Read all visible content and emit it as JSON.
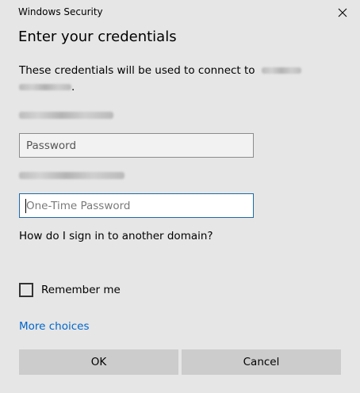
{
  "window": {
    "title": "Windows Security",
    "close_icon": "close-icon"
  },
  "dialog": {
    "heading": "Enter your credentials",
    "description": "These credentials will be used to connect to",
    "description_end": "."
  },
  "form": {
    "password_placeholder": "Password",
    "password_value": "",
    "otp_placeholder": "One-Time Password",
    "otp_value": "",
    "other_domain_text": "How do I sign in to another domain?",
    "remember_label": "Remember me",
    "remember_checked": false,
    "more_choices_label": "More choices"
  },
  "buttons": {
    "ok_label": "OK",
    "cancel_label": "Cancel"
  },
  "colors": {
    "background": "#e6e6e6",
    "link": "#0066cc",
    "focus_border": "#1c6aa8",
    "button": "#cccccc"
  }
}
